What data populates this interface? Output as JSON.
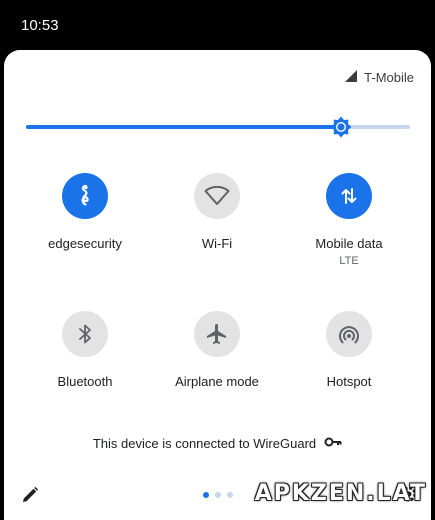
{
  "status_bar": {
    "time": "10:53"
  },
  "panel": {
    "carrier": "T-Mobile",
    "brightness_level": 0.82,
    "tiles": [
      {
        "label": "edgesecurity",
        "sublabel": "",
        "icon": "edgesecurity-icon",
        "active": true
      },
      {
        "label": "Wi-Fi",
        "sublabel": "",
        "icon": "wifi-icon",
        "active": false
      },
      {
        "label": "Mobile data",
        "sublabel": "LTE",
        "icon": "mobile-data-icon",
        "active": true
      },
      {
        "label": "Bluetooth",
        "sublabel": "",
        "icon": "bluetooth-icon",
        "active": false
      },
      {
        "label": "Airplane mode",
        "sublabel": "",
        "icon": "airplane-icon",
        "active": false
      },
      {
        "label": "Hotspot",
        "sublabel": "",
        "icon": "hotspot-icon",
        "active": false
      }
    ],
    "vpn_status": "This device is connected to WireGuard",
    "page_count": 3,
    "current_page": 1
  },
  "watermark": "APKZEN.LAT",
  "colors": {
    "accent": "#1a73e8",
    "tile_off": "#e3e3e3",
    "track": "#c9d7ee"
  }
}
